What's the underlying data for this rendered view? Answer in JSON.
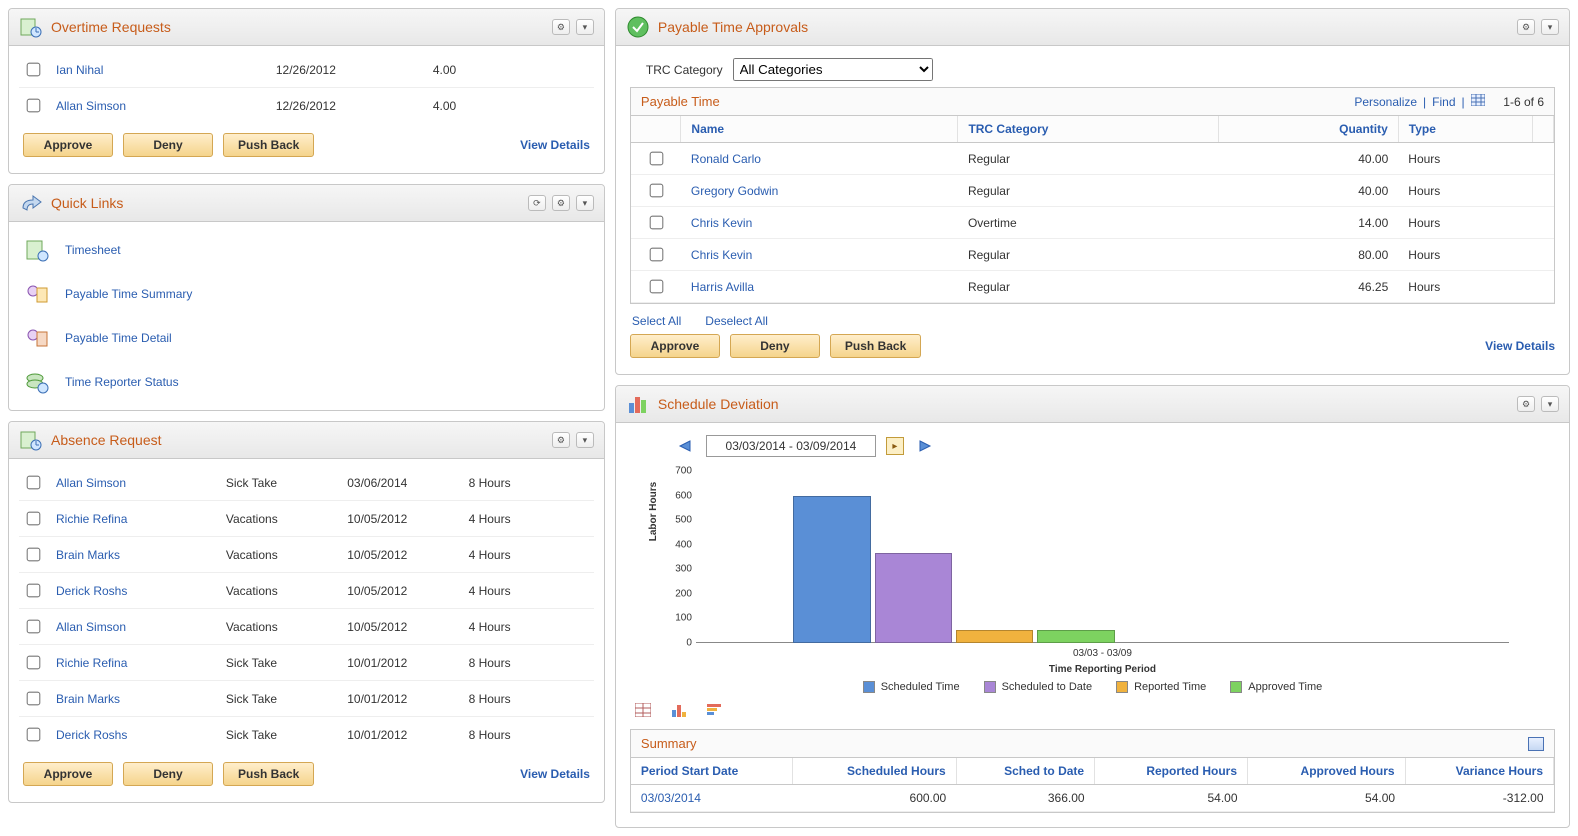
{
  "overtime": {
    "title": "Overtime Requests",
    "rows": [
      {
        "name": "Ian Nihal",
        "date": "12/26/2012",
        "qty": "4.00"
      },
      {
        "name": "Allan Simson",
        "date": "12/26/2012",
        "qty": "4.00"
      }
    ],
    "approve": "Approve",
    "deny": "Deny",
    "pushback": "Push Back",
    "view_details": "View Details"
  },
  "quicklinks": {
    "title": "Quick Links",
    "items": [
      {
        "label": "Timesheet"
      },
      {
        "label": "Payable Time Summary"
      },
      {
        "label": "Payable Time Detail"
      },
      {
        "label": "Time Reporter Status"
      }
    ]
  },
  "absence": {
    "title": "Absence Request",
    "rows": [
      {
        "name": "Allan Simson",
        "type": "Sick Take",
        "date": "03/06/2014",
        "hours": "8 Hours"
      },
      {
        "name": "Richie Refina",
        "type": "Vacations",
        "date": "10/05/2012",
        "hours": "4 Hours"
      },
      {
        "name": "Brain Marks",
        "type": "Vacations",
        "date": "10/05/2012",
        "hours": "4 Hours"
      },
      {
        "name": "Derick Roshs",
        "type": "Vacations",
        "date": "10/05/2012",
        "hours": "4 Hours"
      },
      {
        "name": "Allan Simson",
        "type": "Vacations",
        "date": "10/05/2012",
        "hours": "4 Hours"
      },
      {
        "name": "Richie Refina",
        "type": "Sick Take",
        "date": "10/01/2012",
        "hours": "8 Hours"
      },
      {
        "name": "Brain Marks",
        "type": "Sick Take",
        "date": "10/01/2012",
        "hours": "8 Hours"
      },
      {
        "name": "Derick Roshs",
        "type": "Sick Take",
        "date": "10/01/2012",
        "hours": "8 Hours"
      }
    ],
    "approve": "Approve",
    "deny": "Deny",
    "pushback": "Push Back",
    "view_details": "View Details"
  },
  "payable": {
    "title": "Payable Time Approvals",
    "filter_label": "TRC Category",
    "filter_value": "All Categories",
    "table_title": "Payable Time",
    "personalize": "Personalize",
    "find": "Find",
    "pager": "1-6 of 6",
    "cols": {
      "name": "Name",
      "cat": "TRC Category",
      "qty": "Quantity",
      "type": "Type"
    },
    "rows": [
      {
        "name": "Ronald Carlo",
        "cat": "Regular",
        "qty": "40.00",
        "type": "Hours"
      },
      {
        "name": "Gregory Godwin",
        "cat": "Regular",
        "qty": "40.00",
        "type": "Hours"
      },
      {
        "name": "Chris Kevin",
        "cat": "Overtime",
        "qty": "14.00",
        "type": "Hours"
      },
      {
        "name": "Chris Kevin",
        "cat": "Regular",
        "qty": "80.00",
        "type": "Hours"
      },
      {
        "name": "Harris Avilla",
        "cat": "Regular",
        "qty": "46.25",
        "type": "Hours"
      }
    ],
    "select_all": "Select All",
    "deselect_all": "Deselect All",
    "approve": "Approve",
    "deny": "Deny",
    "pushback": "Push Back",
    "view_details": "View Details"
  },
  "schedule": {
    "title": "Schedule Deviation",
    "date_range": "03/03/2014 - 03/09/2014",
    "chart_data": {
      "type": "bar",
      "title": "",
      "xlabel": "Time Reporting Period",
      "ylabel": "Labor Hours",
      "ylim": [
        0,
        700
      ],
      "yticks": [
        0,
        100,
        200,
        300,
        400,
        500,
        600,
        700
      ],
      "categories": [
        "03/03 - 03/09"
      ],
      "series": [
        {
          "name": "Scheduled Time",
          "values": [
            600
          ],
          "color": "#5a8fd6"
        },
        {
          "name": "Scheduled to Date",
          "values": [
            366
          ],
          "color": "#a986d6"
        },
        {
          "name": "Reported Time",
          "values": [
            54
          ],
          "color": "#f0b23e"
        },
        {
          "name": "Approved Time",
          "values": [
            54
          ],
          "color": "#7dd260"
        }
      ]
    },
    "summary": {
      "title": "Summary",
      "cols": {
        "period": "Period Start Date",
        "sched": "Scheduled Hours",
        "sched_to_date": "Sched to Date",
        "reported": "Reported Hours",
        "approved": "Approved Hours",
        "variance": "Variance Hours"
      },
      "rows": [
        {
          "period": "03/03/2014",
          "sched": "600.00",
          "sched_to_date": "366.00",
          "reported": "54.00",
          "approved": "54.00",
          "variance": "-312.00"
        }
      ]
    }
  }
}
